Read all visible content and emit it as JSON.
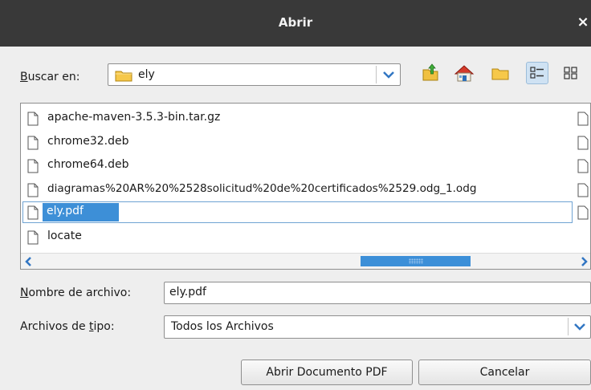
{
  "window": {
    "title": "Abrir",
    "close_icon": "close-icon"
  },
  "lookin": {
    "label": "Buscar en:",
    "mnemonic": "B",
    "label_rest": "uscar en:",
    "folder": "ely"
  },
  "toolbar": {
    "icons": [
      "up-folder-icon",
      "home-icon",
      "new-folder-icon",
      "list-view-icon",
      "details-view-icon"
    ],
    "active": "list-view-icon"
  },
  "files": [
    {
      "name": "apache-maven-3.5.3-bin.tar.gz",
      "selected": false
    },
    {
      "name": "chrome32.deb",
      "selected": false
    },
    {
      "name": "chrome64.deb",
      "selected": false
    },
    {
      "name": "diagramas%20AR%20%2528solicitud%20de%20certificados%2529.odg_1.odg",
      "selected": false
    },
    {
      "name": "ely.pdf",
      "selected": true
    },
    {
      "name": "locate",
      "selected": false
    }
  ],
  "filename": {
    "label": "Nombre de archivo:",
    "mnemonic": "N",
    "label_rest": "ombre de archivo:",
    "value": "ely.pdf"
  },
  "filetype": {
    "label": "Archivos de tipo:",
    "label_pre": "Archivos de ",
    "mnemonic": "t",
    "label_rest": "ipo:",
    "value": "Todos los Archivos"
  },
  "buttons": {
    "open": "Abrir Documento PDF",
    "cancel": "Cancelar"
  },
  "colors": {
    "titlebar": "#393939",
    "selection": "#3d8fd7",
    "accent": "#3c8fd8"
  }
}
